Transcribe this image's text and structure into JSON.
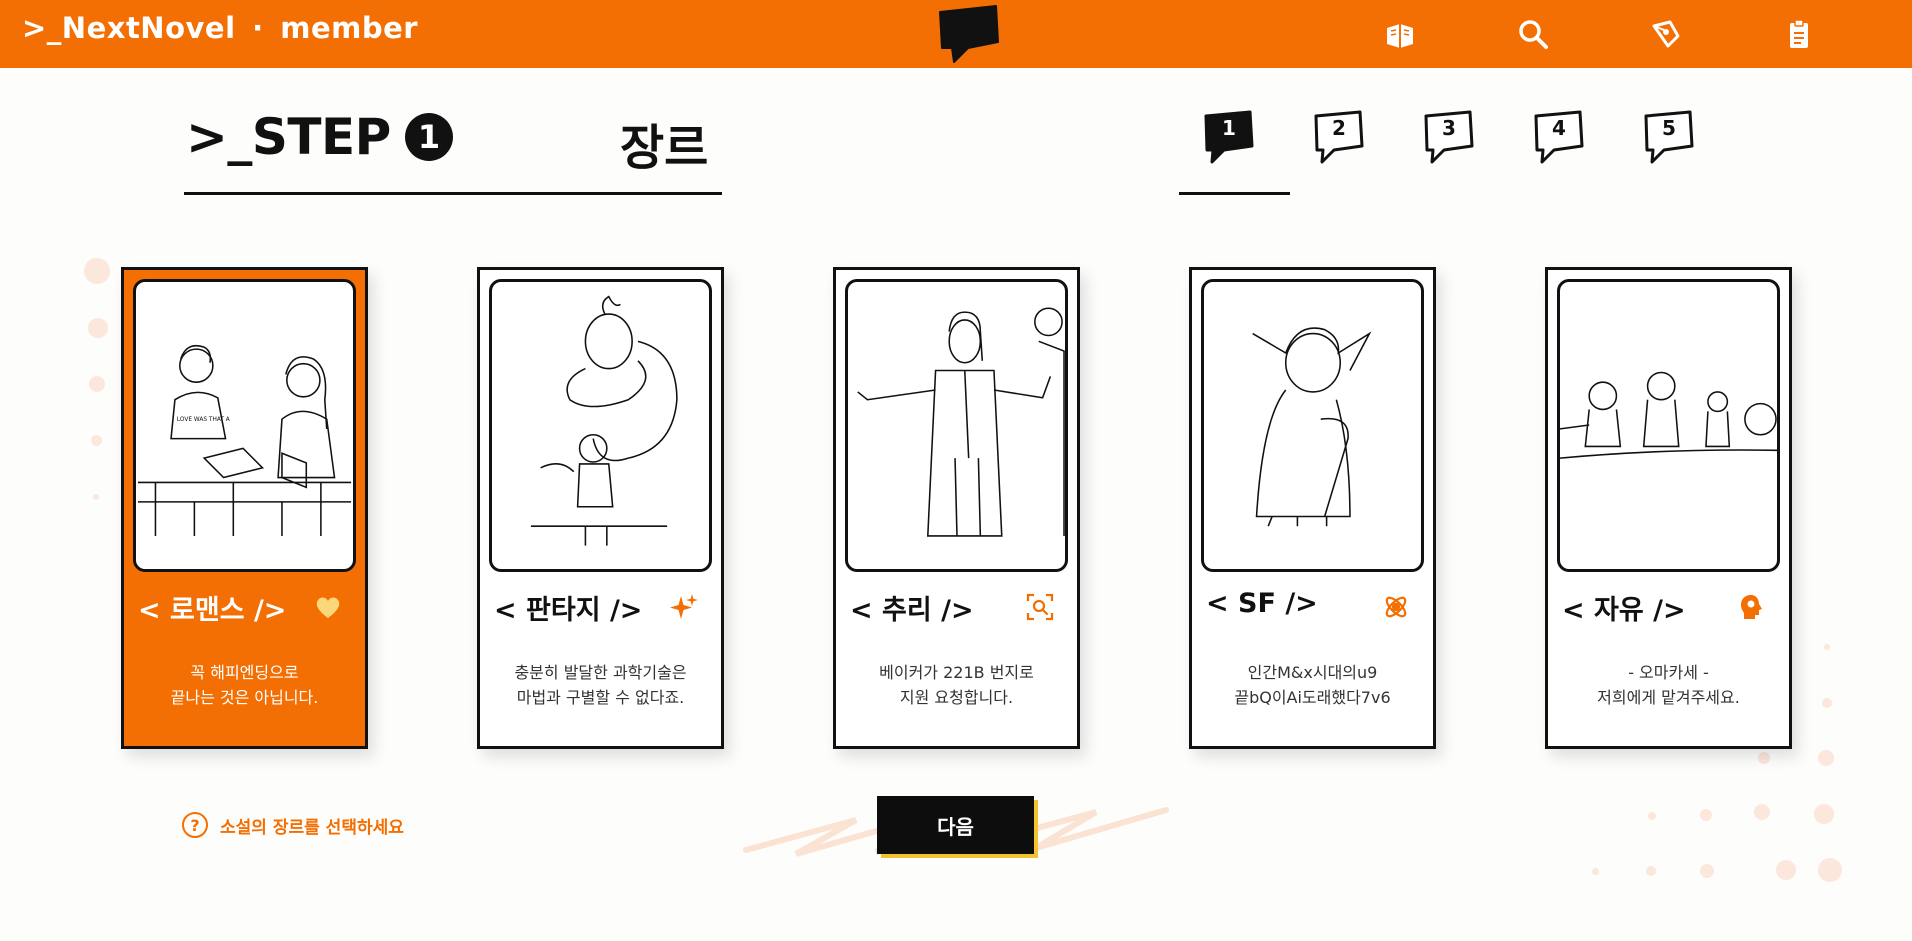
{
  "header": {
    "brand_name": ">_NextNovel",
    "brand_separator": "·",
    "brand_section": "member",
    "icons": [
      "books-icon",
      "search-icon",
      "pen-icon",
      "clipboard-icon"
    ],
    "background": "#f46f03"
  },
  "step": {
    "title": ">_STEP",
    "number": "1",
    "label": "장르",
    "tabs": [
      {
        "label": "1",
        "active": true
      },
      {
        "label": "2",
        "active": false
      },
      {
        "label": "3",
        "active": false
      },
      {
        "label": "4",
        "active": false
      },
      {
        "label": "5",
        "active": false
      }
    ]
  },
  "cards": [
    {
      "name": "< 로맨스 />",
      "icon": "heart-icon",
      "desc_line1": "꼭 해피엔딩으로",
      "desc_line2": "끝나는 것은 아닙니다.",
      "selected": true
    },
    {
      "name": "< 판타지 />",
      "icon": "sparkle-icon",
      "desc_line1": "충분히 발달한 과학기술은",
      "desc_line2": "마법과 구별할 수 없다죠.",
      "selected": false
    },
    {
      "name": "< 추리 />",
      "icon": "magnify-scan-icon",
      "desc_line1": "베이커가 221B 번지로",
      "desc_line2": "지원 요청합니다.",
      "selected": false
    },
    {
      "name": "< SF />",
      "icon": "atom-icon",
      "desc_line1": "인간M&x시대의u9",
      "desc_line2": "끝bQ이Ai도래했다7v6",
      "selected": false
    },
    {
      "name": "< 자유 />",
      "icon": "head-gear-icon",
      "desc_line1": "- 오마카세 -",
      "desc_line2": "저희에게 맡겨주세요.",
      "selected": false
    }
  ],
  "hint": {
    "text": "소설의 장르를 선택하세요",
    "icon": "question-icon"
  },
  "next_button": {
    "label": "다음"
  },
  "colors": {
    "accent": "#f46f03",
    "text": "#111111",
    "button": "#0d0d0d",
    "button_shadow": "#f2c230"
  }
}
